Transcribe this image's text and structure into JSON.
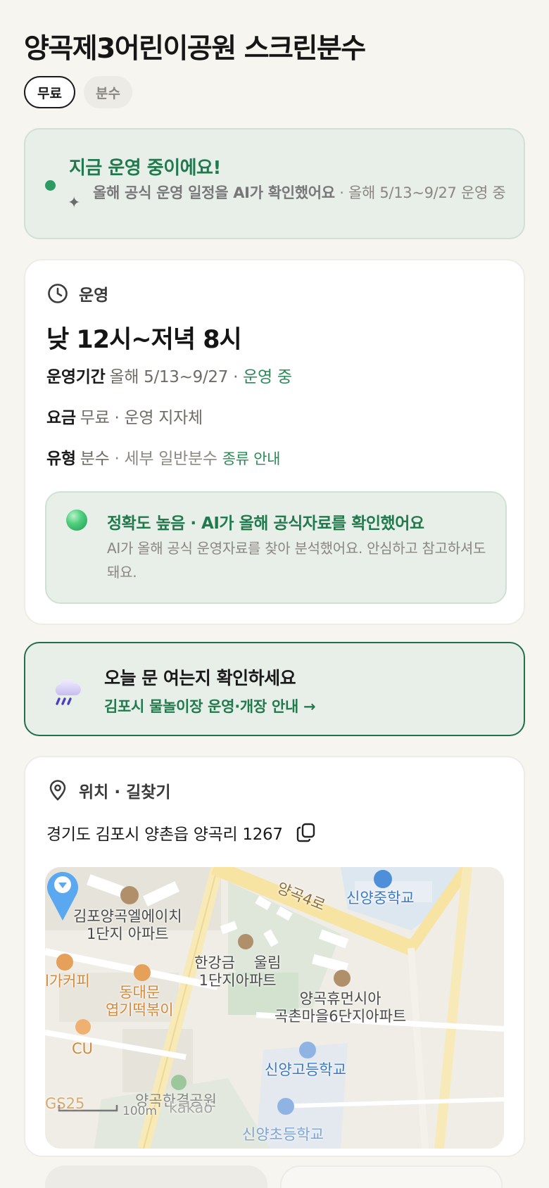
{
  "header": {
    "title": "양곡제3어린이공원 스크린분수",
    "chips": [
      {
        "label": "무료"
      },
      {
        "label": "분수"
      }
    ]
  },
  "status": {
    "title": "지금 운영 중이에요!",
    "line_bold": "올해 공식 운영 일정을 AI가 확인했어요",
    "line_rest": " · 올해 5/13~9/27 운영 중"
  },
  "operation": {
    "heading": "운영",
    "hours": "낮 12시~저녁 8시",
    "period_key": "운영기간",
    "period_value": "올해 5/13~9/27 · ",
    "period_status": "운영 중",
    "fee_key": "요금",
    "fee_value": "무료 · 운영 지자체",
    "type_key": "유형",
    "type_value": "분수",
    "type_detail": " · 세부 일반분수 ",
    "type_link": "종류 안내",
    "accuracy": {
      "title": "정확도 높음 · AI가 올해 공식자료를 확인했어요",
      "desc": "AI가 올해 공식 운영자료를 찾아 분석했어요. 안심하고 참고하셔도 돼요."
    }
  },
  "weather": {
    "title": "오늘 문 여는지 확인하세요",
    "link": "김포시 물놀이장 운영·개장 안내 →"
  },
  "location": {
    "heading": "위치 · 길찾기",
    "address": "경기도 김포시 양촌읍 양곡리 1267",
    "map_labels": {
      "road": "양곡4로",
      "school1": "신양중학교",
      "apt1": "김포양곡엘에이치\n1단지 아파트",
      "apt2": "한강금    울림\n1단지아파트",
      "apt3": "양곡휴먼시아\n곡촌마을6단지아파트",
      "cafe": "l가커피",
      "food": "동대문\n엽기떡볶이",
      "cu": "CU",
      "school2": "신양고등학교",
      "gs": "GS25",
      "park": "양곡한결공원",
      "school3": "신양초등학교",
      "scale": "100m",
      "brand": "kakao"
    }
  }
}
